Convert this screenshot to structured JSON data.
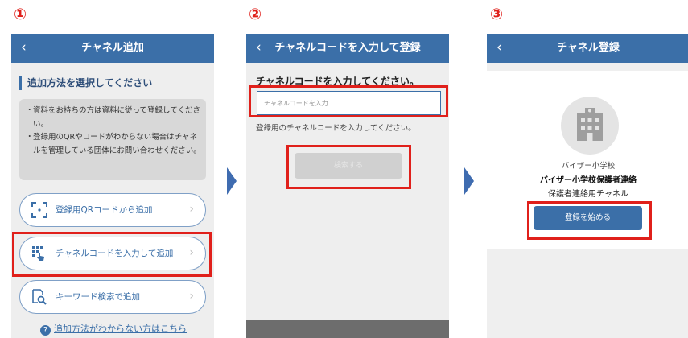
{
  "steps": [
    "①",
    "②",
    "③"
  ],
  "colors": {
    "header": "#3b6fa8",
    "highlight": "#e0201b",
    "step_number": "#e0201b",
    "arrow": "#3f6cb0"
  },
  "screen1": {
    "back_icon": "‹",
    "title": "チャネル追加",
    "section_title": "追加方法を選択してください",
    "notes": [
      "資料をお持ちの方は資料に従って登録してください。",
      "登録用のQRやコードがわからない場合はチャネルを管理している団体にお問い合わせください。"
    ],
    "buttons": [
      {
        "icon": "qr-scan-icon",
        "label": "登録用QRコードから追加",
        "chevron": "›"
      },
      {
        "icon": "keypad-tap-icon",
        "label": "チャネルコードを入力して追加",
        "chevron": "›"
      },
      {
        "icon": "search-doc-icon",
        "label": "キーワード検索で追加",
        "chevron": "›"
      }
    ],
    "help_icon": "?",
    "help_link": "追加方法がわからない方はこちら"
  },
  "screen2": {
    "back_icon": "‹",
    "title": "チャネルコードを入力して登録",
    "prompt": "チャネルコードを入力してください。",
    "input_placeholder": "チャネルコードを入力",
    "input_value": "",
    "hint": "登録用のチャネルコードを入力してください。",
    "search_button": "検索する"
  },
  "screen3": {
    "back_icon": "‹",
    "title": "チャネル登録",
    "school_icon": "school-building-icon",
    "school_name": "バイザー小学校",
    "channel_name": "バイザー小学校保護者連絡",
    "channel_desc": "保護者連絡用チャネル",
    "start_button": "登録を始める"
  }
}
